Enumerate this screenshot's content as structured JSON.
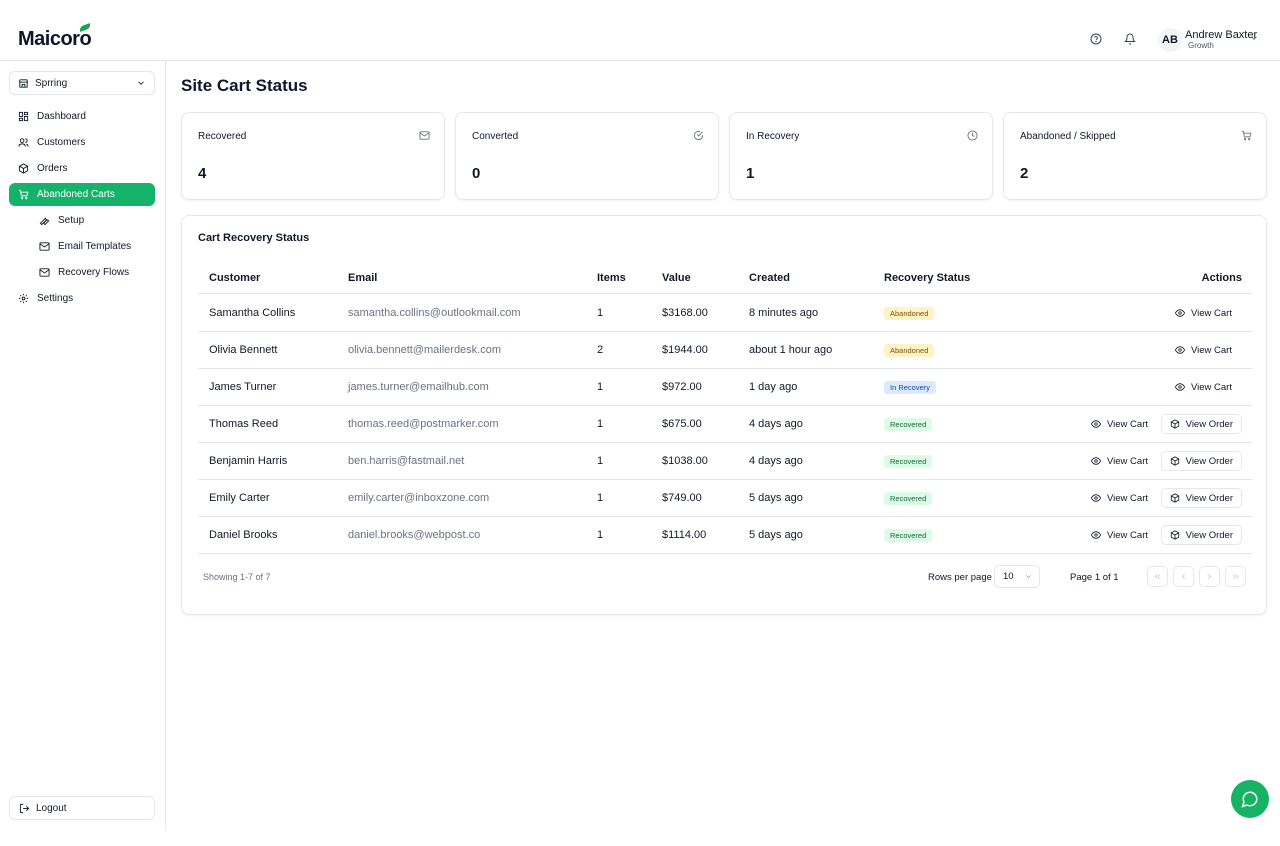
{
  "header": {
    "logo": "Maicoro",
    "user": {
      "initials": "AB",
      "name": "Andrew Baxter",
      "role": "Growth"
    }
  },
  "sidebar": {
    "store": "Sprring",
    "items": [
      {
        "label": "Dashboard",
        "icon": "grid-icon"
      },
      {
        "label": "Customers",
        "icon": "users-icon"
      },
      {
        "label": "Orders",
        "icon": "box-icon"
      },
      {
        "label": "Abandoned Carts",
        "icon": "cart-icon",
        "active": true
      },
      {
        "label": "Setup",
        "icon": "wrench-icon"
      },
      {
        "label": "Email Templates",
        "icon": "mail-icon"
      },
      {
        "label": "Recovery Flows",
        "icon": "mail-icon"
      },
      {
        "label": "Settings",
        "icon": "gear-icon"
      }
    ],
    "logout": "Logout"
  },
  "main": {
    "title": "Site Cart Status",
    "stats": [
      {
        "label": "Recovered",
        "value": "4",
        "icon": "mail-icon"
      },
      {
        "label": "Converted",
        "value": "0",
        "icon": "check-circle-icon"
      },
      {
        "label": "In Recovery",
        "value": "1",
        "icon": "clock-icon"
      },
      {
        "label": "Abandoned / Skipped",
        "value": "2",
        "icon": "cart-icon"
      }
    ],
    "table": {
      "title": "Cart Recovery Status",
      "columns": [
        "Customer",
        "Email",
        "Items",
        "Value",
        "Created",
        "Recovery Status",
        "Actions"
      ],
      "view_cart": "View Cart",
      "view_order": "View Order",
      "rows": [
        {
          "customer": "Samantha Collins",
          "email": "samantha.collins@outlookmail.com",
          "items": "1",
          "value": "$3168.00",
          "created": "8 minutes ago",
          "status": "Abandoned"
        },
        {
          "customer": "Olivia Bennett",
          "email": "olivia.bennett@mailerdesk.com",
          "items": "2",
          "value": "$1944.00",
          "created": "about 1 hour ago",
          "status": "Abandoned"
        },
        {
          "customer": "James Turner",
          "email": "james.turner@emailhub.com",
          "items": "1",
          "value": "$972.00",
          "created": "1 day ago",
          "status": "In Recovery"
        },
        {
          "customer": "Thomas Reed",
          "email": "thomas.reed@postmarker.com",
          "items": "1",
          "value": "$675.00",
          "created": "4 days ago",
          "status": "Recovered"
        },
        {
          "customer": "Benjamin Harris",
          "email": "ben.harris@fastmail.net",
          "items": "1",
          "value": "$1038.00",
          "created": "4 days ago",
          "status": "Recovered"
        },
        {
          "customer": "Emily Carter",
          "email": "emily.carter@inboxzone.com",
          "items": "1",
          "value": "$749.00",
          "created": "5 days ago",
          "status": "Recovered"
        },
        {
          "customer": "Daniel Brooks",
          "email": "daniel.brooks@webpost.co",
          "items": "1",
          "value": "$1114.00",
          "created": "5 days ago",
          "status": "Recovered"
        }
      ],
      "showing": "Showing 1-7 of 7",
      "rows_per_page_label": "Rows per page",
      "rows_per_page": "10",
      "page": "Page 1 of 1"
    }
  },
  "colors": {
    "accent": "#15b36a",
    "abandoned_bg": "#fdf4c4",
    "in_recovery_bg": "#dbeafe",
    "recovered_bg": "#dcfce7"
  }
}
